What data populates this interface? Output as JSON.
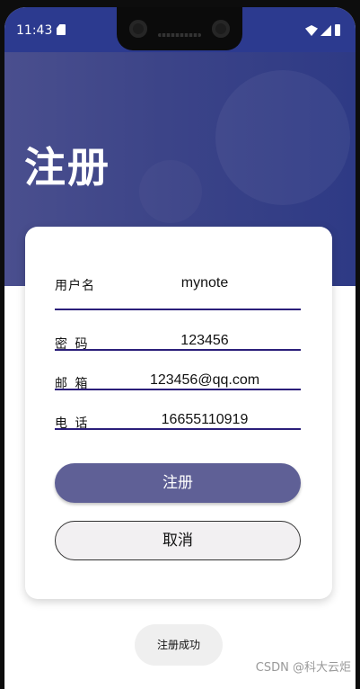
{
  "status_bar": {
    "time": "11:43"
  },
  "header": {
    "title": "注册"
  },
  "form": {
    "username": {
      "label": "用户名",
      "value": "mynote"
    },
    "password": {
      "label": "密 码",
      "value": "123456"
    },
    "email": {
      "label": "邮 箱",
      "value": "123456@qq.com"
    },
    "phone": {
      "label": "电 话",
      "value": "16655110919"
    }
  },
  "buttons": {
    "register_label": "注册",
    "cancel_label": "取消"
  },
  "toast": {
    "message": "注册成功"
  },
  "watermark": {
    "text": "CSDN @科大云炬"
  },
  "colors": {
    "header": "#3c4488",
    "underline": "#2b1e7a",
    "register_button": "#5f6096",
    "cancel_button": "#f2f0f2"
  }
}
